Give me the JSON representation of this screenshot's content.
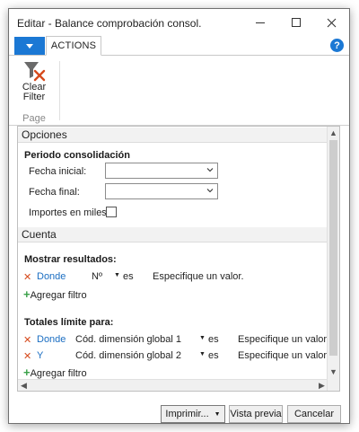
{
  "window": {
    "title": "Editar - Balance comprobación consol."
  },
  "ribbon": {
    "tab_actions": "ACTIONS",
    "help_glyph": "?",
    "clear_filter_line1": "Clear",
    "clear_filter_line2": "Filter",
    "group_label": "Page"
  },
  "sections": {
    "opciones": {
      "title": "Opciones",
      "group_title": "Periodo consolidación",
      "fecha_inicial_label": "Fecha inicial:",
      "fecha_inicial_value": "",
      "fecha_final_label": "Fecha final:",
      "fecha_final_value": "",
      "importes_label": "Importes en miles:",
      "importes_checked": false
    },
    "cuenta": {
      "title": "Cuenta",
      "mostrar_title": "Mostrar resultados:",
      "mostrar_filters": [
        {
          "prefix": "Donde",
          "field": "Nº",
          "operator": "es",
          "value": "Especifique un valor."
        }
      ],
      "add_filter_label": "Agregar filtro",
      "totales_title": "Totales límite para:",
      "totales_filters": [
        {
          "prefix": "Donde",
          "field": "Cód. dimensión global 1",
          "operator": "es",
          "value": "Especifique un valor."
        },
        {
          "prefix": "Y",
          "field": "Cód. dimensión global 2",
          "operator": "es",
          "value": "Especifique un valor."
        }
      ],
      "add_filter_label_2": "Agregar filtro"
    }
  },
  "footer": {
    "print_label": "Imprimir...",
    "preview_label": "Vista previa",
    "cancel_label": "Cancelar"
  },
  "colors": {
    "accent": "#1b78d4",
    "remove": "#d64a1c",
    "add": "#3ba14a",
    "link": "#1b6ec2"
  },
  "icons": {
    "clear_filter": "funnel-clear-icon",
    "help": "help-icon",
    "remove": "remove-x-icon",
    "add": "plus-icon"
  }
}
